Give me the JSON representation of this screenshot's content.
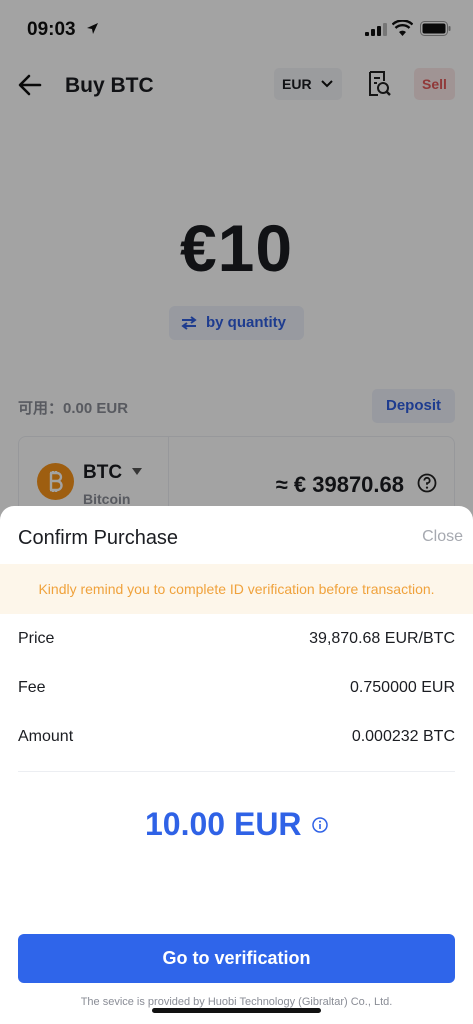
{
  "status_bar": {
    "time": "09:03"
  },
  "nav": {
    "title": "Buy BTC",
    "currency": "EUR",
    "sell_label": "Sell"
  },
  "purchase": {
    "amount": "€10",
    "toggle_label": "by quantity",
    "available": "可用：0.00 EUR",
    "deposit_label": "Deposit",
    "coin_code": "BTC",
    "coin_name": "Bitcoin",
    "estimated_price": "≈ € 39870.68"
  },
  "sheet": {
    "title": "Confirm Purchase",
    "close_label": "Close",
    "notice": "Kindly remind you to complete ID verification before transaction.",
    "rows": [
      {
        "label": "Price",
        "value": "39,870.68 EUR/BTC"
      },
      {
        "label": "Fee",
        "value": "0.750000 EUR"
      },
      {
        "label": "Amount",
        "value": "0.000232 BTC"
      }
    ],
    "total": "10.00 EUR",
    "verify_label": "Go to verification",
    "footer": "The sevice is provided by Huobi Technology (Gibraltar) Co., Ltd."
  },
  "colors": {
    "accent": "#2f65ea",
    "notice_text": "#f0a23c",
    "sell_text": "#e25a5a",
    "bitcoin": "#f7931a"
  }
}
